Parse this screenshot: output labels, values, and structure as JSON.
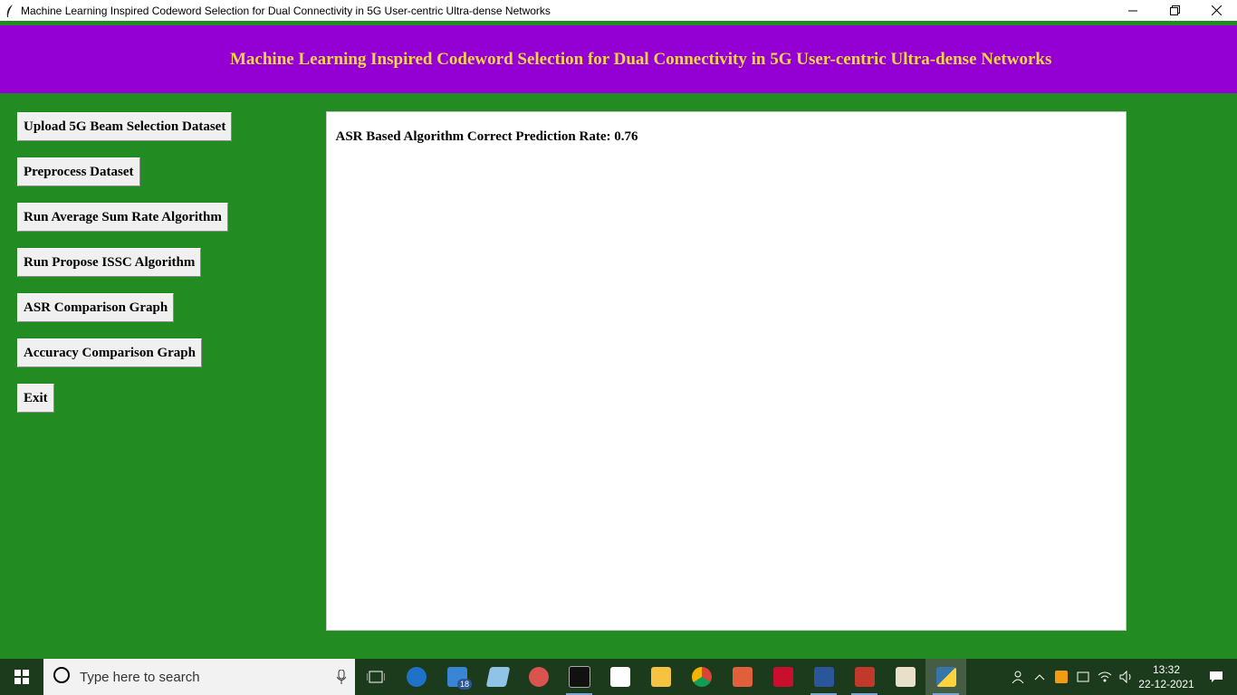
{
  "window": {
    "title": "Machine Learning Inspired Codeword Selection for Dual Connectivity in 5G User-centric Ultra-dense Networks",
    "minimize_icon": "minimize-icon",
    "restore_icon": "restore-icon",
    "close_icon": "close-icon"
  },
  "header": {
    "title": "Machine Learning Inspired Codeword Selection for Dual Connectivity in 5G User-centric Ultra-dense Networks"
  },
  "buttons": {
    "upload": "Upload 5G Beam Selection Dataset",
    "preprocess": "Preprocess Dataset",
    "run_asr": "Run Average Sum Rate Algorithm",
    "run_issc": "Run Propose ISSC Algorithm",
    "asr_graph": "ASR Comparison Graph",
    "accuracy_graph": "Accuracy Comparison Graph",
    "exit": "Exit"
  },
  "output": {
    "text": "ASR Based Algorithm Correct Prediction Rate: 0.76"
  },
  "taskbar": {
    "search_placeholder": "Type here to search",
    "mail_badge": "18",
    "time": "13:32",
    "date": "22-12-2021"
  },
  "colors": {
    "background": "#228b22",
    "header_bg": "#9400d3",
    "header_text": "#f5d742"
  }
}
